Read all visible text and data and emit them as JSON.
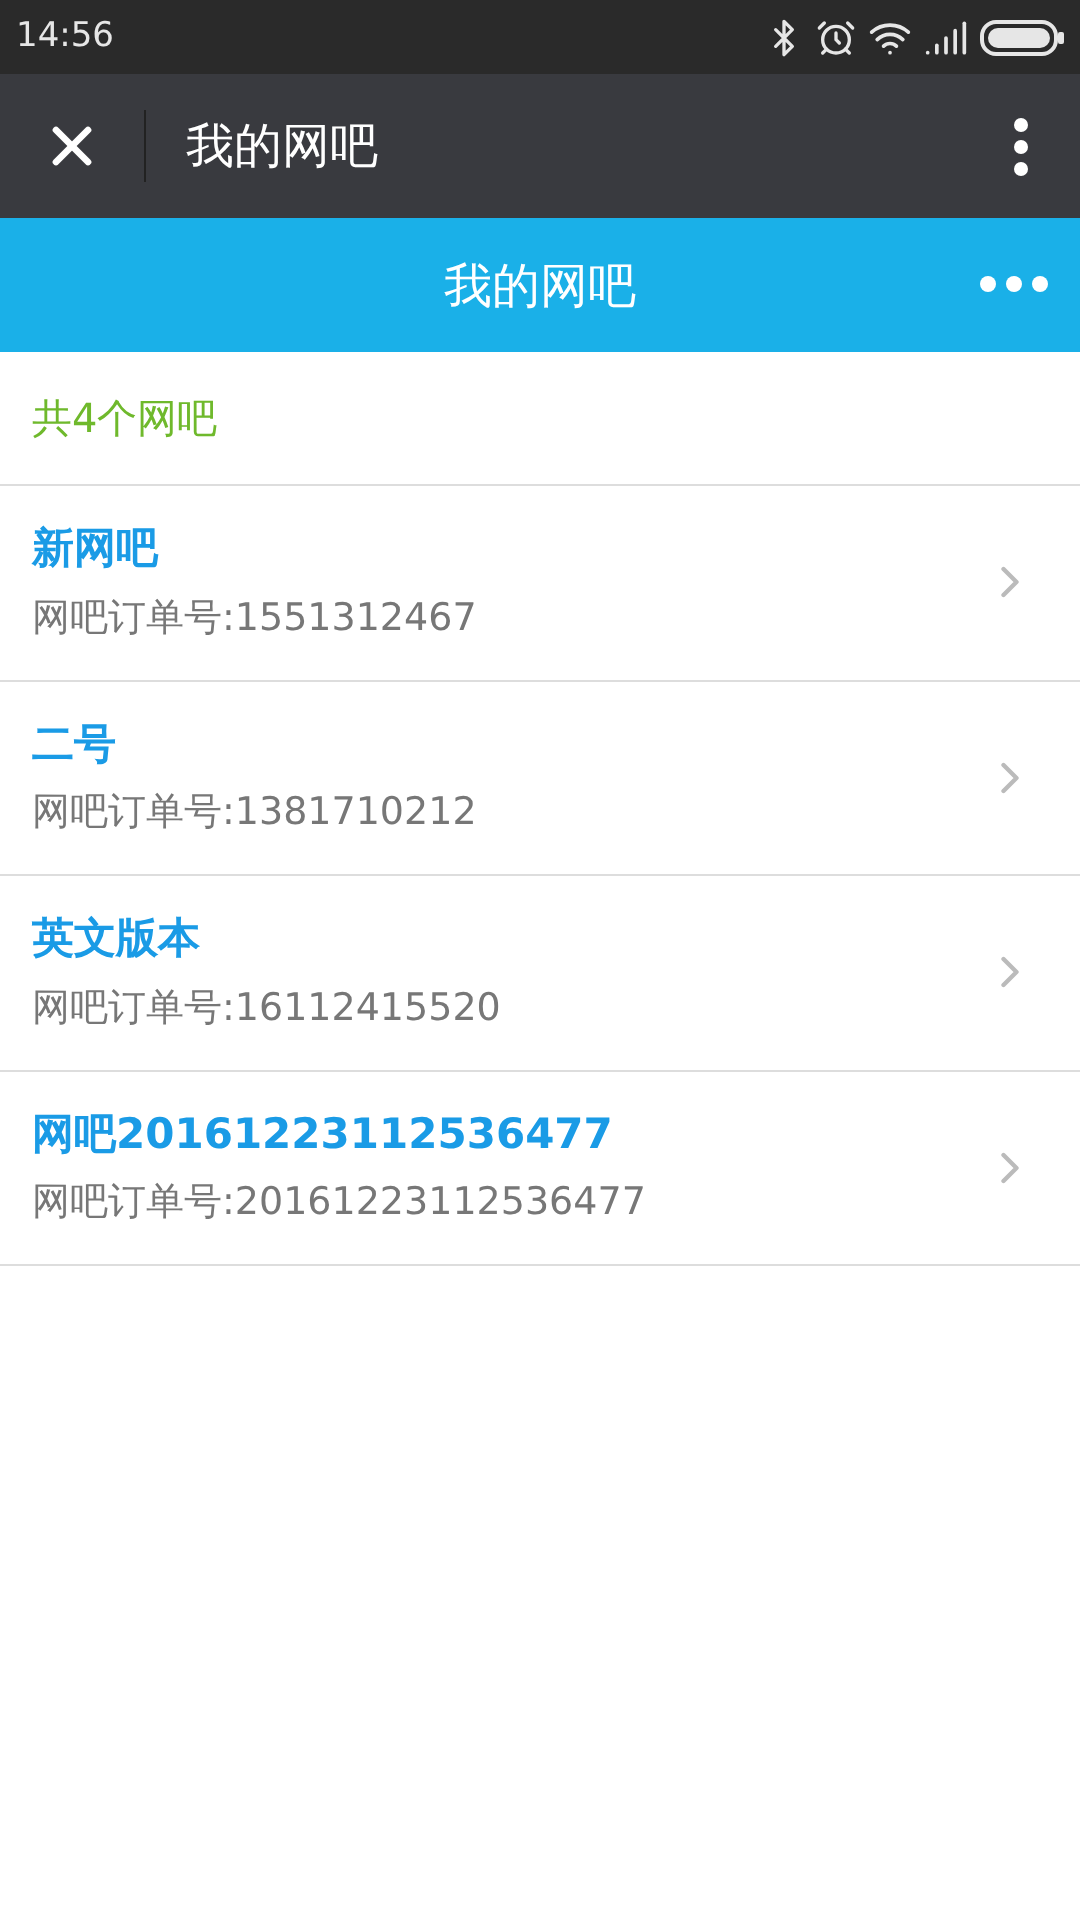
{
  "status_bar": {
    "time": "14:56"
  },
  "nav_bar": {
    "title": "我的网吧"
  },
  "header": {
    "title": "我的网吧"
  },
  "summary": "共4个网吧",
  "cafes": [
    {
      "name": "新网吧",
      "order": "网吧订单号:1551312467"
    },
    {
      "name": "二号",
      "order": "网吧订单号:1381710212"
    },
    {
      "name": "英文版本",
      "order": "网吧订单号:16112415520"
    },
    {
      "name": "网吧20161223112536477",
      "order": "网吧订单号:20161223112536477"
    }
  ]
}
